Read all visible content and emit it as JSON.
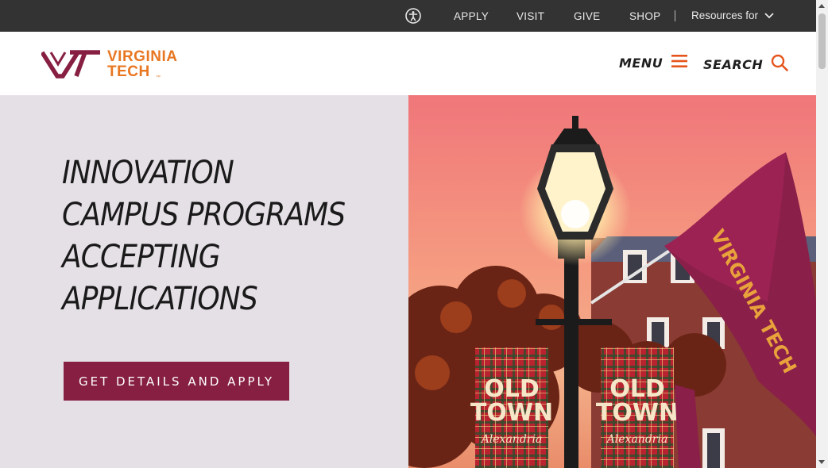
{
  "utility_nav": {
    "accessibility_icon": "accessibility-icon",
    "links": [
      "APPLY",
      "VISIT",
      "GIVE",
      "SHOP"
    ],
    "resources_label": "Resources for",
    "resources_icon": "chevron-down-icon"
  },
  "header": {
    "logo_line1": "VIRGINIA",
    "logo_line2": "TECH",
    "logo_tm": "™",
    "menu_label": "MENU",
    "search_label": "SEARCH"
  },
  "hero": {
    "headline_lines": [
      "INNOVATION",
      "CAMPUS PROGRAMS",
      "ACCEPTING",
      "APPLICATIONS"
    ],
    "cta_label": "GET DETAILS AND APPLY",
    "photo": {
      "banner_text_line1": "OLD",
      "banner_text_line2": "TOWN",
      "banner_script": "Alexandria",
      "flag_text": "VIRGINIA TECH"
    }
  },
  "colors": {
    "maroon": "#861f41",
    "orange": "#e87722",
    "utility_bar": "#333333",
    "hero_bg": "#e5dfe6"
  }
}
